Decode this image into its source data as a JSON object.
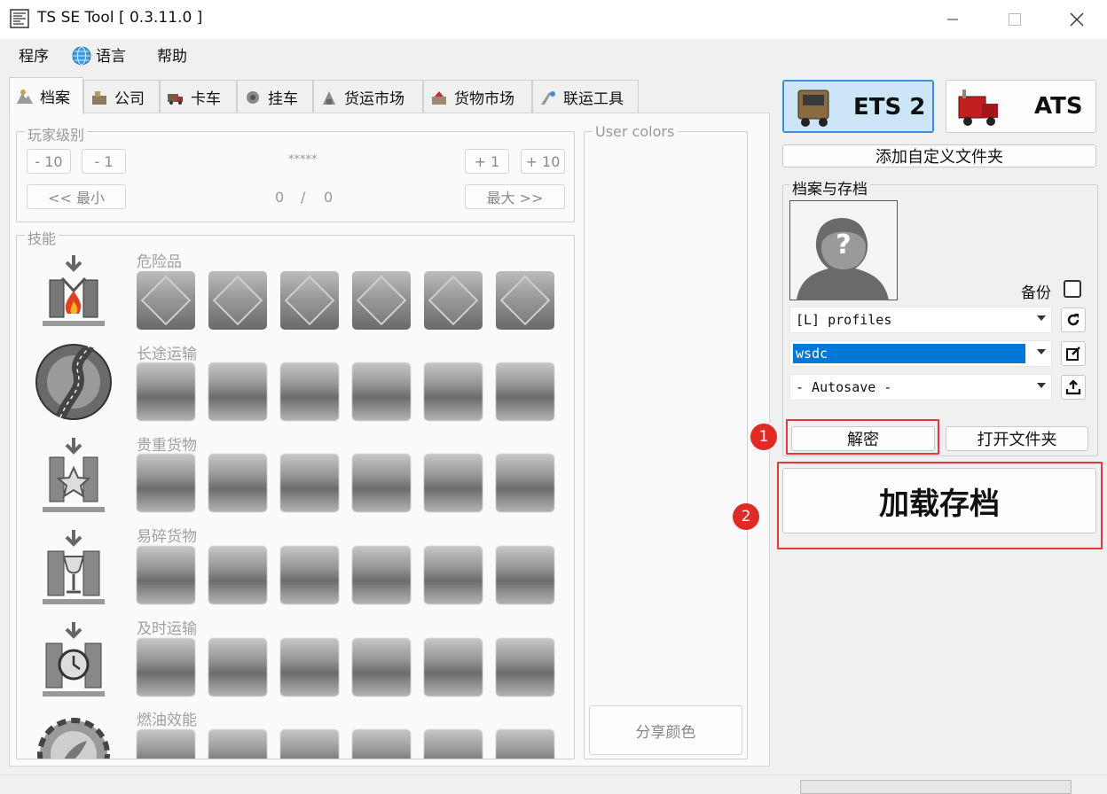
{
  "window": {
    "title": "TS SE Tool [ 0.3.11.0 ]"
  },
  "menu": {
    "program": "程序",
    "language": "语言",
    "help": "帮助"
  },
  "tabs": [
    {
      "label": "档案",
      "icon": "profile-icon"
    },
    {
      "label": "公司",
      "icon": "company-icon"
    },
    {
      "label": "卡车",
      "icon": "truck-icon"
    },
    {
      "label": "挂车",
      "icon": "trailer-icon"
    },
    {
      "label": "货运市场",
      "icon": "freight-market-icon"
    },
    {
      "label": "货物市场",
      "icon": "cargo-market-icon"
    },
    {
      "label": "联运工具",
      "icon": "convoy-tools-icon"
    }
  ],
  "player_level": {
    "group_label": "玩家级别",
    "minus10": "- 10",
    "minus1": "- 1",
    "plus1": "+ 1",
    "plus10": "+ 10",
    "stars": "*****",
    "min_btn": "<< 最小",
    "max_btn": "最大 >>",
    "current": "0",
    "sep": "/",
    "total": "0"
  },
  "skills": {
    "group_label": "技能",
    "rows": [
      {
        "label": "危险品",
        "icon": "adr-skill-icon"
      },
      {
        "label": "长途运输",
        "icon": "long-distance-skill-icon"
      },
      {
        "label": "贵重货物",
        "icon": "high-value-cargo-skill-icon"
      },
      {
        "label": "易碎货物",
        "icon": "fragile-cargo-skill-icon"
      },
      {
        "label": "及时运输",
        "icon": "just-in-time-skill-icon"
      },
      {
        "label": "燃油效能",
        "icon": "eco-driving-skill-icon"
      }
    ]
  },
  "user_colors": {
    "group_label": "User colors",
    "share_btn": "分享颜色"
  },
  "games": {
    "ets2": "ETS 2",
    "ats": "ATS"
  },
  "add_folder_btn": "添加自定义文件夹",
  "profiles_group": {
    "label": "档案与存档",
    "backup_label": "备份",
    "profile_dir": "[L] profiles",
    "profile_name": "wsdc",
    "save_name": "- Autosave -",
    "decrypt_btn": "解密",
    "open_folder_btn": "打开文件夹",
    "load_btn": "加载存档"
  },
  "badges": {
    "one": "1",
    "two": "2"
  },
  "colors": {
    "accent_blue": "#0078d7",
    "annotation_red": "#e03b3b"
  }
}
